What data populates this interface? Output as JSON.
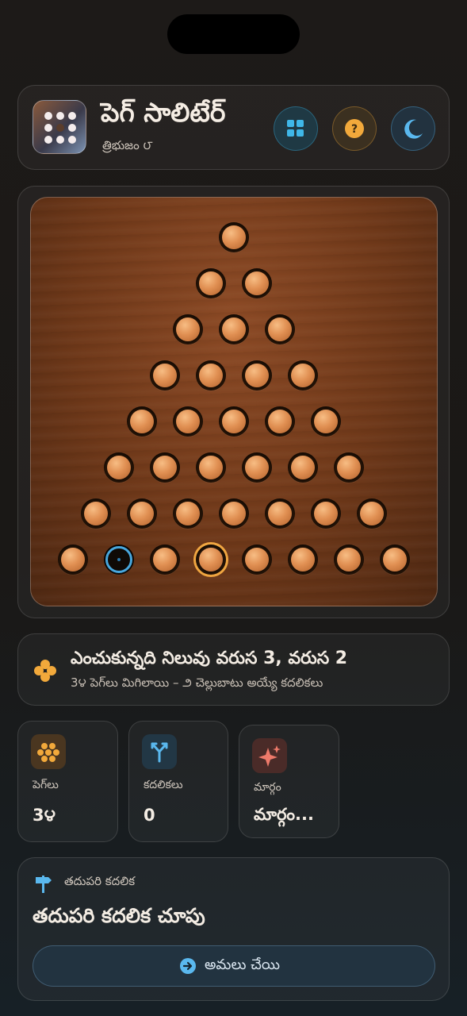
{
  "header": {
    "title": "పెగ్ సాలిటేర్",
    "subtitle": "త్రిభుజం ౮",
    "buttons": [
      {
        "icon": "grid-icon",
        "color": "#3fb7e8"
      },
      {
        "icon": "help-icon",
        "color": "#f2a93b"
      },
      {
        "icon": "moon-icon",
        "color": "#5ab8ee"
      }
    ]
  },
  "board": {
    "shape": "triangle",
    "rows": 8,
    "empty_hole": {
      "row": 7,
      "col": 1
    },
    "selected_peg": {
      "row": 7,
      "col": 3
    },
    "peg_color": "#e08f52",
    "selected_color": "#f0a641",
    "target_color": "#48a7dd"
  },
  "status": {
    "icon": "peg-cluster-icon",
    "title": "ఎంచుకున్నది నిలువు వరుస 3, వరుస 2",
    "subtitle": "3౪ పెగ్‌లు మిగిలాయి – ౨ చెల్లుబాటు అయ్యే కదలికలు"
  },
  "stats": [
    {
      "label": "పెగ్‌లు",
      "value": "3౪",
      "icon": "pegs-icon",
      "color": "#f2a93b"
    },
    {
      "label": "కదలికలు",
      "value": "0",
      "icon": "split-arrows-icon",
      "color": "#5ab8ee"
    },
    {
      "label": "మార్గం",
      "value": "మార్గం...",
      "icon": "sparkle-icon",
      "color": "#ee7a6a"
    }
  ],
  "hint": {
    "icon": "signpost-icon",
    "label": "తదుపరి కదలిక",
    "title": "తదుపరి కదలిక చూపు",
    "button_icon": "arrow-circle-icon",
    "button_label": "అమలు చేయి"
  }
}
